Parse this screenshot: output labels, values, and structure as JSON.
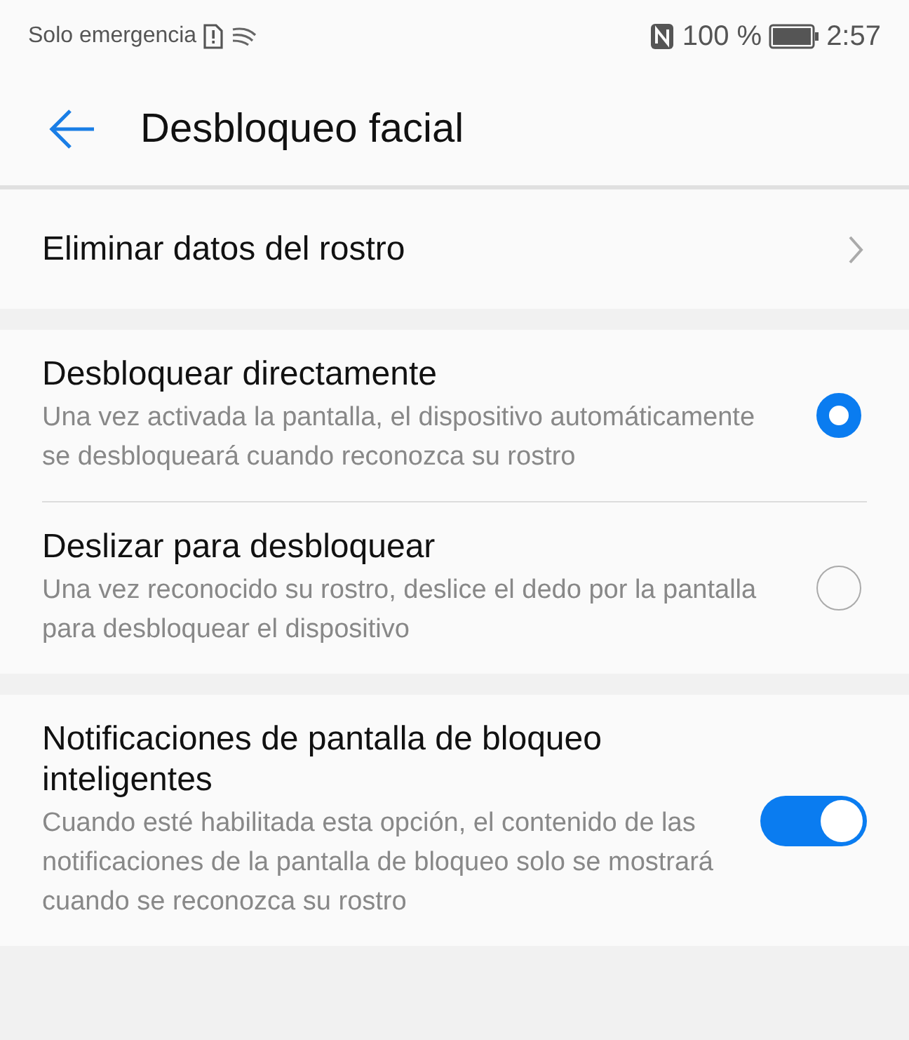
{
  "status_bar": {
    "carrier": "Solo emergencia",
    "battery_text": "100 %",
    "time": "2:57"
  },
  "header": {
    "title": "Desbloqueo facial"
  },
  "sections": [
    {
      "items": [
        {
          "kind": "link",
          "title": "Eliminar datos del rostro"
        }
      ]
    },
    {
      "items": [
        {
          "kind": "radio",
          "title": "Desbloquear directamente",
          "description": "Una vez activada la pantalla, el dispositivo automáticamente se desbloqueará cuando reconozca su rostro",
          "selected": true
        },
        {
          "kind": "radio",
          "title": "Deslizar para desbloquear",
          "description": "Una vez reconocido su rostro, deslice el dedo por la pantalla para desbloquear el dispositivo",
          "selected": false
        }
      ]
    },
    {
      "items": [
        {
          "kind": "toggle",
          "title": "Notificaciones de pantalla de bloqueo inteligentes",
          "description": "Cuando esté habilitada esta opción, el contenido de las notificaciones de la pantalla de bloqueo solo se mostrará cuando se reconozca su rostro",
          "on": true
        }
      ]
    }
  ]
}
